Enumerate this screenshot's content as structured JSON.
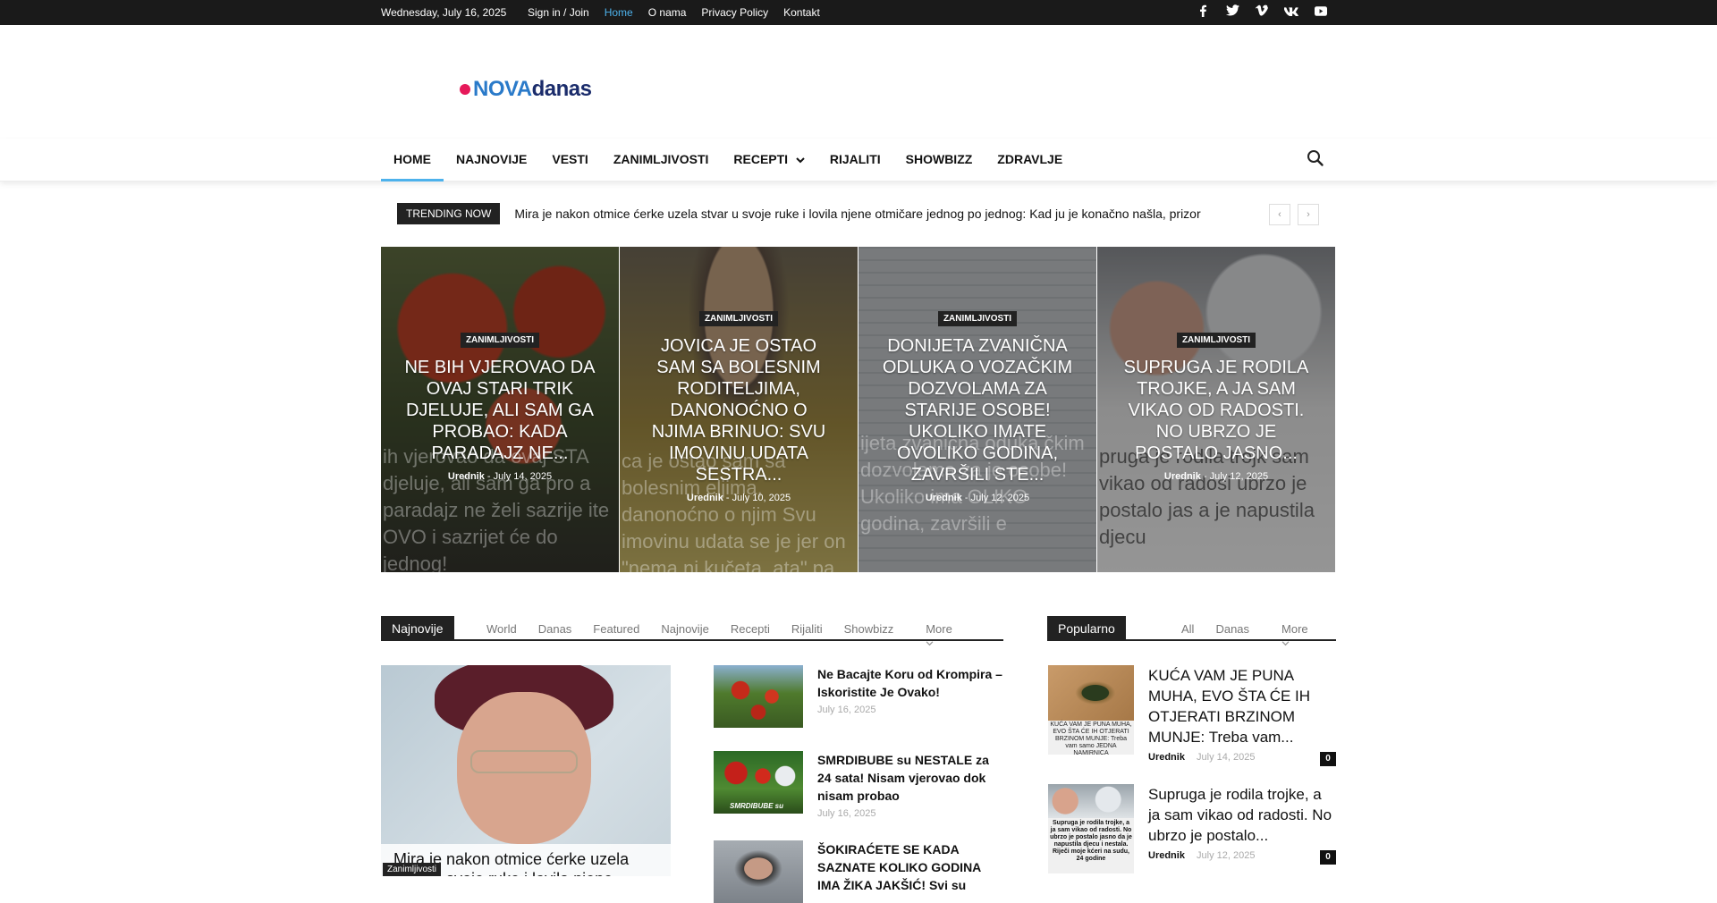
{
  "topbar": {
    "date": "Wednesday, July 16, 2025",
    "links": [
      "Sign in / Join",
      "Home",
      "O nama",
      "Privacy Policy",
      "Kontakt"
    ],
    "social_icons": [
      "facebook-icon",
      "twitter-icon",
      "vimeo-icon",
      "vk-icon",
      "youtube-icon"
    ]
  },
  "logo": {
    "part1": "NOVA",
    "part2": "danas",
    "dot_color": "#e6195a",
    "nova_color": "#2a7ac9",
    "danas_color": "#1b2c6b"
  },
  "menu": {
    "items": [
      "HOME",
      "NAJNOVIJE",
      "VESTI",
      "ZANIMLJIVOSTI",
      "RECEPTI",
      "RIJALITI",
      "SHOWBIZZ",
      "ZDRAVLJE"
    ],
    "accent": "#4db2ec"
  },
  "trending": {
    "badge": "TRENDING NOW",
    "text": "Mira je nakon otmice ćerke uzela stvar u svoje ruke i lovila njene otmičare jednog po jednog: Kad ju je konačno našla, prizor",
    "prev": "‹",
    "next": "›"
  },
  "featured": [
    {
      "category": "ZANIMLJIVOSTI",
      "title": "NE BIH VJEROVAO DA OVAJ STARI TRIK DJELUJE, ALI SAM GA PROBAO: KADA PARADAJZ NE...",
      "author": "Urednik",
      "date": "July 14, 2025",
      "bgtext": "ih vjerovao da ovaj STA djeluje, ali sam ga pro a paradajz ne želi sazrije ite OVO i sazrijet će do jednog!"
    },
    {
      "category": "ZANIMLJIVOSTI",
      "title": "JOVICA JE OSTAO SAM SA BOLESNIM RODITELJIMA, DANONOĆNO O NJIMA BRINUO: SVU IMOVINU UDATA SESTRA...",
      "author": "Urednik",
      "date": "July 10, 2025",
      "bgtext": "ca je ostao sam sa bolesnim eljima, danonoćno o njim Svu imovinu udata se je jer on \"nema ni kučeta, ata\" pa zažalila"
    },
    {
      "category": "ZANIMLJIVOSTI",
      "title": "DONIJETA ZVANIČNA ODLUKA O VOZAČKIM DOZVOLAMA ZA STARIJE OSOBE! UKOLIKO IMATE OVOLIKO GODINA, ZAVRŠILI STE...",
      "author": "Urednik",
      "date": "July 12, 2025",
      "bgtext": "ijeta zvanična oduka čkim dozvolama za je osobe! Ukoliko ima OLIKO godina, završili e"
    },
    {
      "category": "ZANIMLJIVOSTI",
      "title": "SUPRUGA JE RODILA TROJKE, A JA SAM VIKAO OD RADOSTI. NO UBRZO JE POSTALO JASNO...",
      "author": "Urednik",
      "date": "July 12, 2025",
      "bgtext": "pruga je rodila trojk sam vikao od radosi ubrzo je postalo jas a je napustila djecu"
    }
  ],
  "najnovije": {
    "label": "Najnovije",
    "tabs": [
      "World",
      "Danas",
      "Featured",
      "Najnovije",
      "Recepti",
      "Rijaliti",
      "Showbizz",
      "More"
    ],
    "big": {
      "title": "Mira je nakon otmice ćerke uzela stvar u svoje ruke i lovila njene",
      "category": "Zanimljivosti"
    },
    "list": [
      {
        "title": "Ne Bacajte Koru od Krompira – Iskoristite Je Ovako!",
        "date": "July 16, 2025"
      },
      {
        "title": "SMRDIBUBE su NESTALE za 24 sata! Nisam vjerovao dok nisam probao",
        "date": "July 16, 2025",
        "thumb_label": "SMRDIBUBE su"
      },
      {
        "title": "ŠOKIRAĆETE SE KADA SAZNATE KOLIKO GODINA IMA ŽIKA JAKŠIĆ! Svi su",
        "date": ""
      }
    ]
  },
  "popularno": {
    "label": "Popularno",
    "tabs": [
      "All",
      "Danas",
      "More"
    ],
    "posts": [
      {
        "title": "KUĆA VAM JE PUNA MUHA, EVO ŠTA ĆE IH OTJERATI BRZINOM MUNJE: Treba vam...",
        "author": "Urednik",
        "date": "July 14, 2025",
        "count": "0",
        "thumb_text": "KUĆA VAM JE PUNA MUHA, EVO ŠTA ĆE IH OTJERATI BRZINOM MUNJE: Treba vam samo JEDNA NAMIRNICA"
      },
      {
        "title": "Supruga je rodila trojke, a ja sam vikao od radosti. No ubrzo je postalo...",
        "author": "Urednik",
        "date": "July 12, 2025",
        "count": "0",
        "thumb_text": "Supruga je rodila trojke, a ja sam vikao od radosti. No ubrzo je postalo jasno da je napustila djecu i nestala. Riječi moje kćeri na sudu, 24 godine"
      }
    ]
  }
}
